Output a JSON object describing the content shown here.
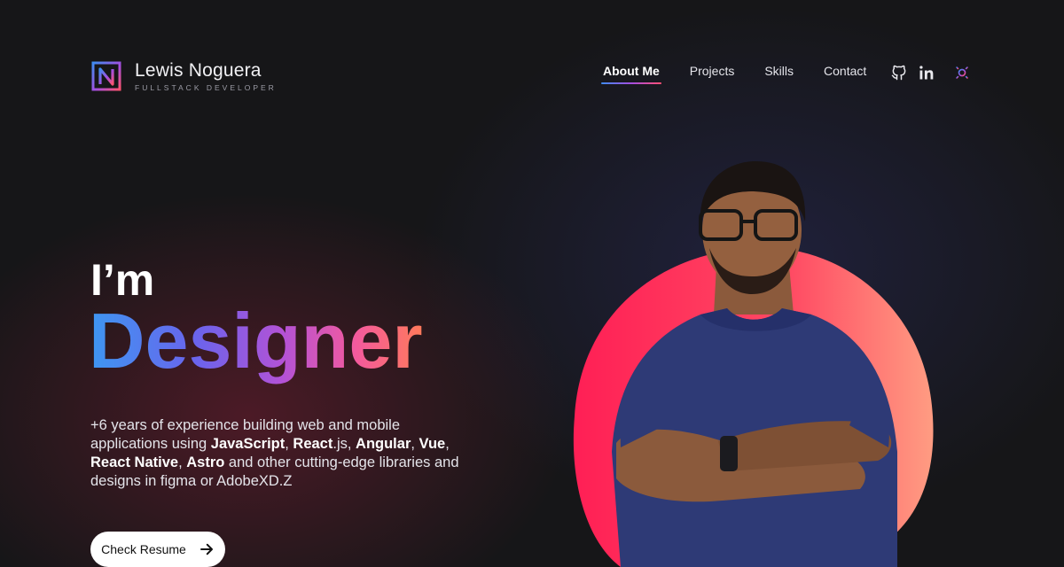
{
  "brand": {
    "name": "Lewis Noguera",
    "subtitle": "FULLSTACK DEVELOPER",
    "logo_letter": "N"
  },
  "nav": [
    {
      "label": "About Me",
      "active": true
    },
    {
      "label": "Projects",
      "active": false
    },
    {
      "label": "Skills",
      "active": false
    },
    {
      "label": "Contact",
      "active": false
    }
  ],
  "icons": [
    "github-icon",
    "linkedin-icon",
    "theme-toggle-icon"
  ],
  "hero": {
    "greeting": "I’m",
    "role": "Designer",
    "description": {
      "t1": "+6 years of experience building web and mobile applications using ",
      "s1": "JavaScript",
      "t2": ", ",
      "s2": "React",
      "t3": ".js, ",
      "s3": "Angular",
      "t4": ", ",
      "s4": "Vue",
      "t5": ", ",
      "s5": "React Native",
      "t6": ", ",
      "s6": "Astro",
      "t7": " and other cutting-edge libraries and designs in figma or AdobeXD.Z"
    },
    "cta": "Check Resume"
  },
  "colors": {
    "accent_blue": "#3d97f2",
    "accent_purple": "#a44ee0",
    "accent_pink": "#ff4f74",
    "blob": "#ff2f5a"
  }
}
